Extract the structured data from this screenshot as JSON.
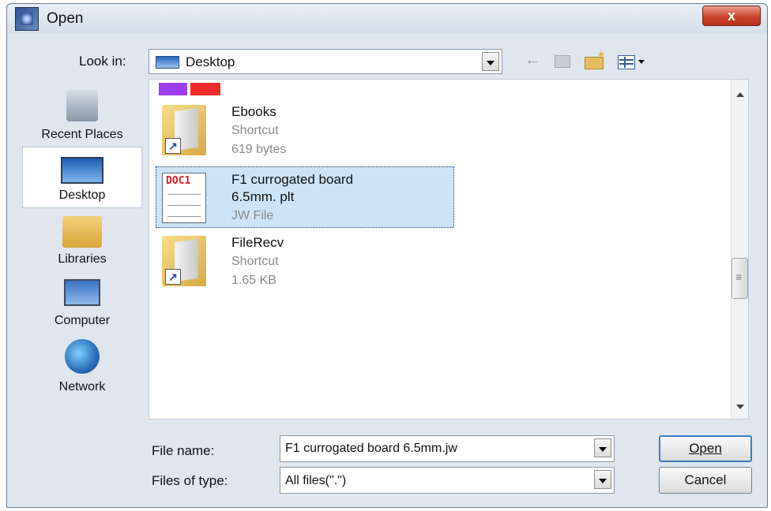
{
  "window": {
    "title": "Open",
    "close_label": "x"
  },
  "toolbar": {
    "look_in_label": "Look in:",
    "look_in_value": "Desktop",
    "back_icon": "back-arrow-icon",
    "up_icon": "up-one-level-icon",
    "new_folder_icon": "new-folder-icon",
    "views_icon": "views-menu-icon"
  },
  "places": [
    {
      "label": "Recent Places",
      "icon": "recent-places-icon"
    },
    {
      "label": "Desktop",
      "icon": "desktop-icon",
      "selected": true
    },
    {
      "label": "Libraries",
      "icon": "libraries-icon"
    },
    {
      "label": "Computer",
      "icon": "computer-icon"
    },
    {
      "label": "Network",
      "icon": "network-icon"
    }
  ],
  "files": [
    {
      "name": "Ebooks",
      "type": "Shortcut",
      "size": "619 bytes",
      "icon": "folder-shortcut-icon"
    },
    {
      "name_line1": "F1 currogated board",
      "name_line2": "6.5mm. plt",
      "type": "JW File",
      "thumb_text": "DOC1",
      "icon": "document-icon",
      "selected": true
    },
    {
      "name": "FileRecv",
      "type": "Shortcut",
      "size": "1.65 KB",
      "icon": "folder-shortcut-icon"
    }
  ],
  "colors": {
    "swatch_purple": "#9f3ef0",
    "swatch_red": "#ef2b2b",
    "selection": "#cde4f7"
  },
  "footer": {
    "file_name_label": "File name:",
    "file_name_value": "F1 currogated board 6.5mm.jw",
    "file_type_label": "Files of type:",
    "file_type_value": "All files(\".\")",
    "open_label": "Open",
    "cancel_label": "Cancel"
  }
}
